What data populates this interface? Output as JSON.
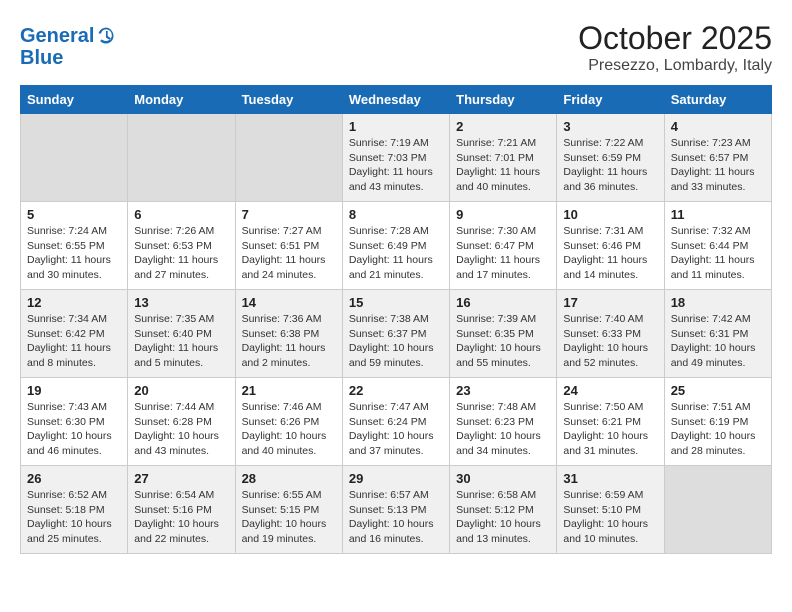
{
  "header": {
    "logo_line1": "General",
    "logo_line2": "Blue",
    "month": "October 2025",
    "location": "Presezzo, Lombardy, Italy"
  },
  "days_of_week": [
    "Sunday",
    "Monday",
    "Tuesday",
    "Wednesday",
    "Thursday",
    "Friday",
    "Saturday"
  ],
  "weeks": [
    [
      {
        "day": "",
        "text": ""
      },
      {
        "day": "",
        "text": ""
      },
      {
        "day": "",
        "text": ""
      },
      {
        "day": "1",
        "text": "Sunrise: 7:19 AM\nSunset: 7:03 PM\nDaylight: 11 hours and 43 minutes."
      },
      {
        "day": "2",
        "text": "Sunrise: 7:21 AM\nSunset: 7:01 PM\nDaylight: 11 hours and 40 minutes."
      },
      {
        "day": "3",
        "text": "Sunrise: 7:22 AM\nSunset: 6:59 PM\nDaylight: 11 hours and 36 minutes."
      },
      {
        "day": "4",
        "text": "Sunrise: 7:23 AM\nSunset: 6:57 PM\nDaylight: 11 hours and 33 minutes."
      }
    ],
    [
      {
        "day": "5",
        "text": "Sunrise: 7:24 AM\nSunset: 6:55 PM\nDaylight: 11 hours and 30 minutes."
      },
      {
        "day": "6",
        "text": "Sunrise: 7:26 AM\nSunset: 6:53 PM\nDaylight: 11 hours and 27 minutes."
      },
      {
        "day": "7",
        "text": "Sunrise: 7:27 AM\nSunset: 6:51 PM\nDaylight: 11 hours and 24 minutes."
      },
      {
        "day": "8",
        "text": "Sunrise: 7:28 AM\nSunset: 6:49 PM\nDaylight: 11 hours and 21 minutes."
      },
      {
        "day": "9",
        "text": "Sunrise: 7:30 AM\nSunset: 6:47 PM\nDaylight: 11 hours and 17 minutes."
      },
      {
        "day": "10",
        "text": "Sunrise: 7:31 AM\nSunset: 6:46 PM\nDaylight: 11 hours and 14 minutes."
      },
      {
        "day": "11",
        "text": "Sunrise: 7:32 AM\nSunset: 6:44 PM\nDaylight: 11 hours and 11 minutes."
      }
    ],
    [
      {
        "day": "12",
        "text": "Sunrise: 7:34 AM\nSunset: 6:42 PM\nDaylight: 11 hours and 8 minutes."
      },
      {
        "day": "13",
        "text": "Sunrise: 7:35 AM\nSunset: 6:40 PM\nDaylight: 11 hours and 5 minutes."
      },
      {
        "day": "14",
        "text": "Sunrise: 7:36 AM\nSunset: 6:38 PM\nDaylight: 11 hours and 2 minutes."
      },
      {
        "day": "15",
        "text": "Sunrise: 7:38 AM\nSunset: 6:37 PM\nDaylight: 10 hours and 59 minutes."
      },
      {
        "day": "16",
        "text": "Sunrise: 7:39 AM\nSunset: 6:35 PM\nDaylight: 10 hours and 55 minutes."
      },
      {
        "day": "17",
        "text": "Sunrise: 7:40 AM\nSunset: 6:33 PM\nDaylight: 10 hours and 52 minutes."
      },
      {
        "day": "18",
        "text": "Sunrise: 7:42 AM\nSunset: 6:31 PM\nDaylight: 10 hours and 49 minutes."
      }
    ],
    [
      {
        "day": "19",
        "text": "Sunrise: 7:43 AM\nSunset: 6:30 PM\nDaylight: 10 hours and 46 minutes."
      },
      {
        "day": "20",
        "text": "Sunrise: 7:44 AM\nSunset: 6:28 PM\nDaylight: 10 hours and 43 minutes."
      },
      {
        "day": "21",
        "text": "Sunrise: 7:46 AM\nSunset: 6:26 PM\nDaylight: 10 hours and 40 minutes."
      },
      {
        "day": "22",
        "text": "Sunrise: 7:47 AM\nSunset: 6:24 PM\nDaylight: 10 hours and 37 minutes."
      },
      {
        "day": "23",
        "text": "Sunrise: 7:48 AM\nSunset: 6:23 PM\nDaylight: 10 hours and 34 minutes."
      },
      {
        "day": "24",
        "text": "Sunrise: 7:50 AM\nSunset: 6:21 PM\nDaylight: 10 hours and 31 minutes."
      },
      {
        "day": "25",
        "text": "Sunrise: 7:51 AM\nSunset: 6:19 PM\nDaylight: 10 hours and 28 minutes."
      }
    ],
    [
      {
        "day": "26",
        "text": "Sunrise: 6:52 AM\nSunset: 5:18 PM\nDaylight: 10 hours and 25 minutes."
      },
      {
        "day": "27",
        "text": "Sunrise: 6:54 AM\nSunset: 5:16 PM\nDaylight: 10 hours and 22 minutes."
      },
      {
        "day": "28",
        "text": "Sunrise: 6:55 AM\nSunset: 5:15 PM\nDaylight: 10 hours and 19 minutes."
      },
      {
        "day": "29",
        "text": "Sunrise: 6:57 AM\nSunset: 5:13 PM\nDaylight: 10 hours and 16 minutes."
      },
      {
        "day": "30",
        "text": "Sunrise: 6:58 AM\nSunset: 5:12 PM\nDaylight: 10 hours and 13 minutes."
      },
      {
        "day": "31",
        "text": "Sunrise: 6:59 AM\nSunset: 5:10 PM\nDaylight: 10 hours and 10 minutes."
      },
      {
        "day": "",
        "text": ""
      }
    ]
  ]
}
